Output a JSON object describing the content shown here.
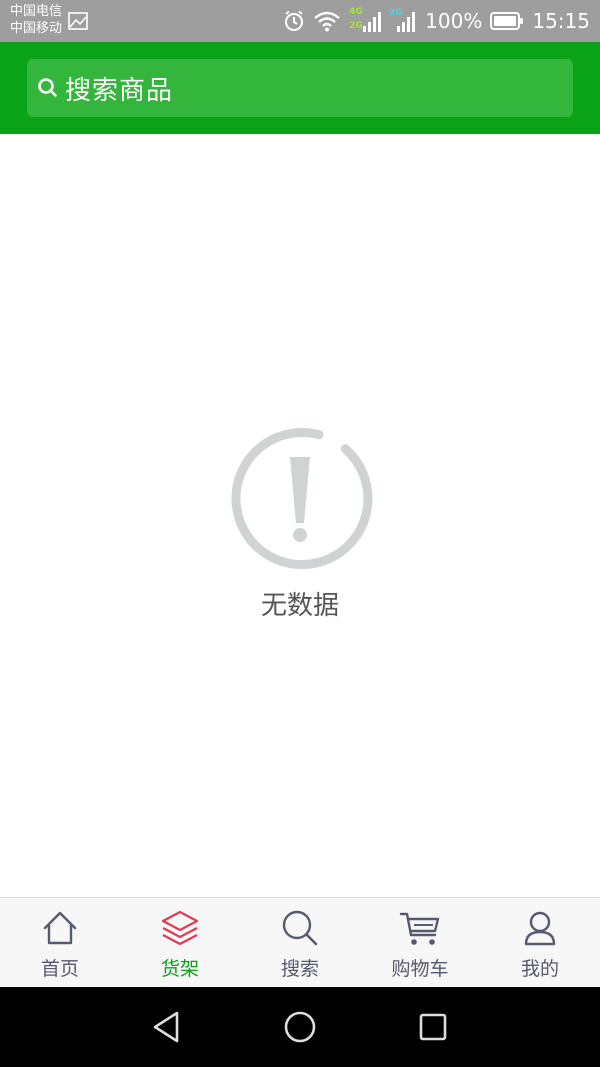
{
  "status_bar": {
    "carrier_1": "中国电信",
    "carrier_2": "中国移动",
    "network_tag_4g": "4G",
    "network_tag_2g": "2G",
    "network_tag_2g_second": "2G",
    "battery": "100%",
    "time": "15:15",
    "icons": [
      "image-icon",
      "alarm-icon",
      "wifi-icon",
      "signal-icon",
      "battery-icon"
    ]
  },
  "search": {
    "placeholder": "搜索商品",
    "icon": "search-icon"
  },
  "empty_state": {
    "icon": "exclamation-circle-icon",
    "message": "无数据"
  },
  "tab_bar": {
    "items": [
      {
        "label": "首页",
        "icon": "home-icon",
        "active": false
      },
      {
        "label": "货架",
        "icon": "layers-icon",
        "active": true
      },
      {
        "label": "搜索",
        "icon": "search-icon",
        "active": false
      },
      {
        "label": "购物车",
        "icon": "cart-icon",
        "active": false
      },
      {
        "label": "我的",
        "icon": "user-icon",
        "active": false
      }
    ]
  },
  "nav_bar": {
    "icons": [
      "back-icon",
      "home-circle-icon",
      "recents-icon"
    ]
  },
  "colors": {
    "brand_green": "#0aa317",
    "search_bg": "#34b53b",
    "active_tab_icon": "#e23a55",
    "inactive_tab": "#555a6e",
    "empty_icon": "#cfd3d3"
  }
}
